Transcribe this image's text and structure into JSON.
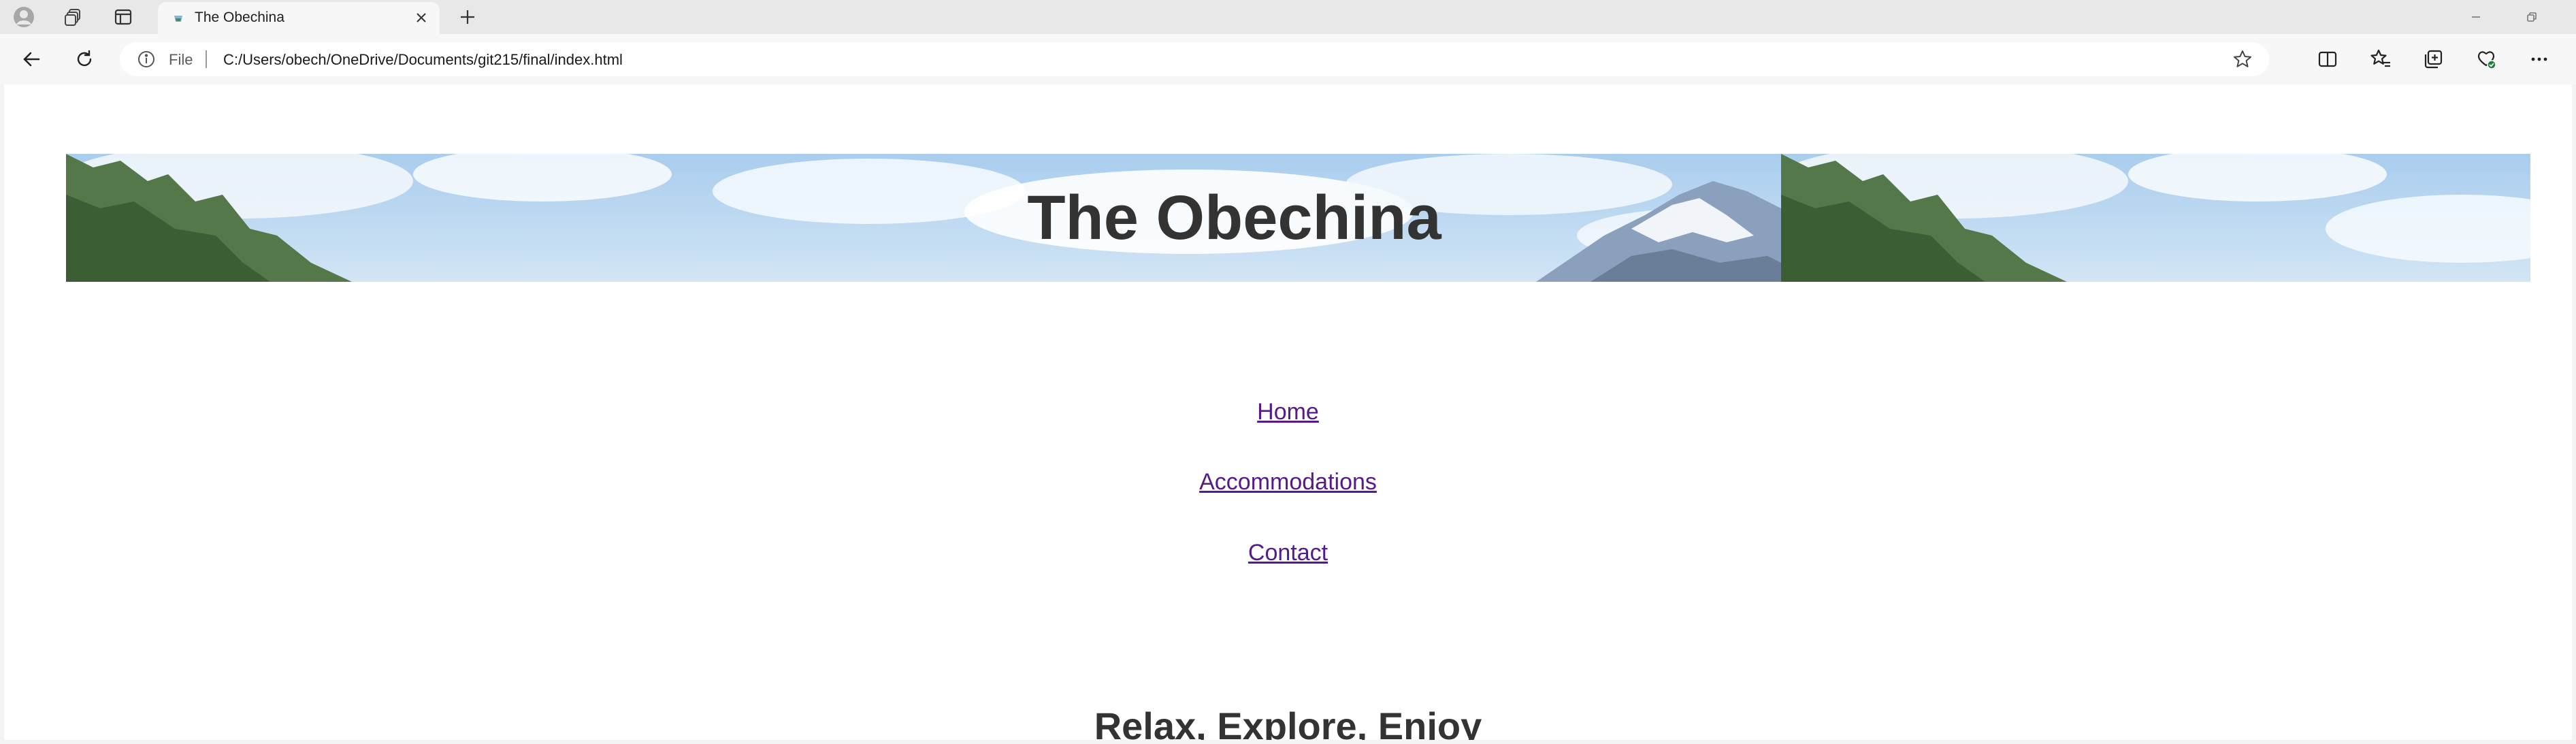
{
  "browser": {
    "tab": {
      "title": "The Obechina"
    },
    "address_bar": {
      "scheme_label": "File",
      "url": "C:/Users/obech/OneDrive/Documents/git215/final/index.html"
    },
    "icons": {
      "profile": "profile-icon",
      "workspaces": "workspaces-icon",
      "tab_actions": "tab-actions-icon",
      "new_tab": "plus-icon",
      "back": "back-arrow-icon",
      "refresh": "refresh-icon",
      "site_info": "info-icon",
      "favorite": "star-icon",
      "split_screen": "split-screen-icon",
      "favorites": "favorites-icon",
      "collections": "collections-icon",
      "browser_essentials": "browser-essentials-icon",
      "more": "more-icon"
    }
  },
  "page": {
    "banner_title": "The Obechina",
    "nav": [
      {
        "label": "Home"
      },
      {
        "label": "Accommodations"
      },
      {
        "label": "Contact"
      }
    ],
    "heading": "Relax, Explore, Enjoy",
    "link_color": "#551a8b",
    "text_color": "#333333"
  }
}
